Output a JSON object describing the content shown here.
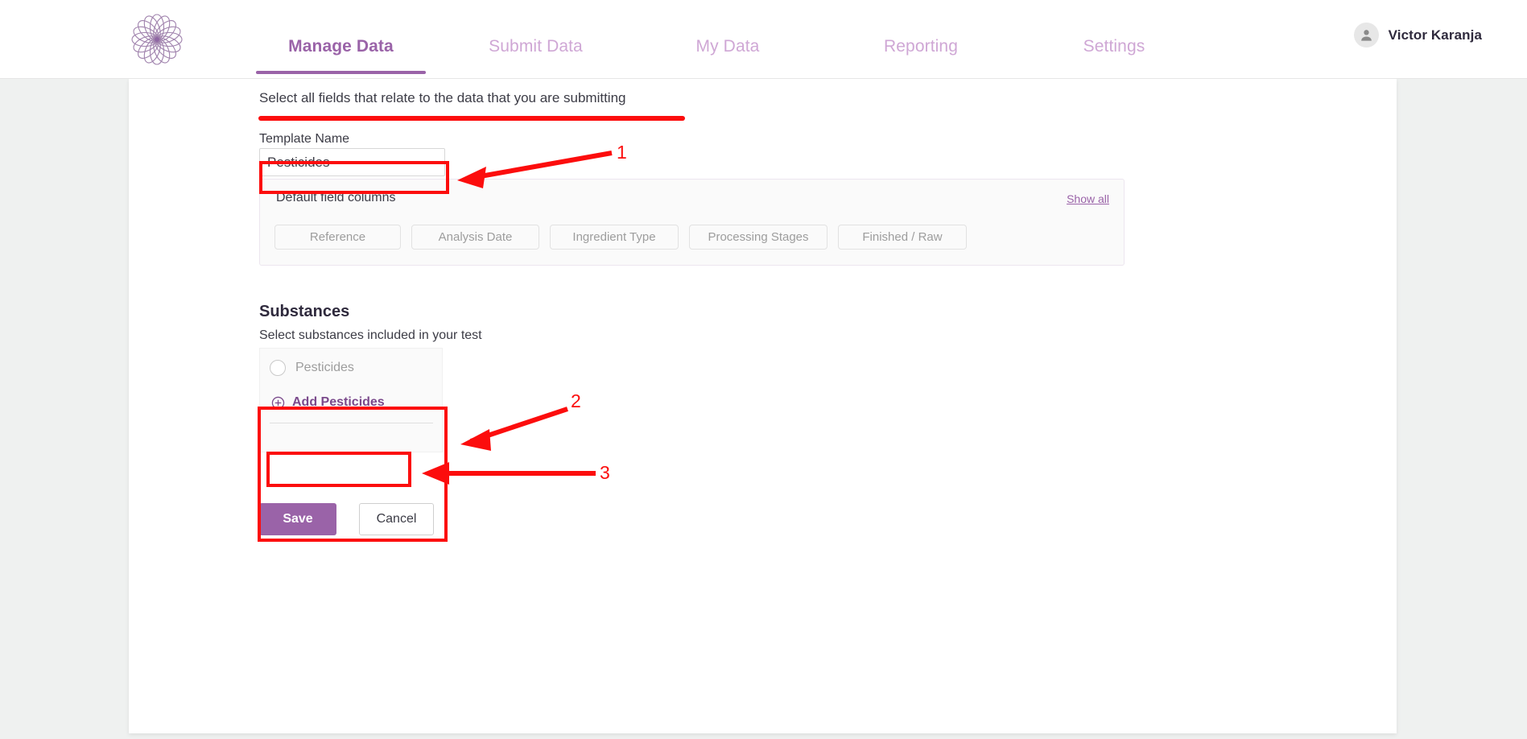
{
  "brand": {
    "logo_icon": "flower-mandala-logo",
    "accent_color": "#9a63a8",
    "nav_inactive_color": "#cfa7d5",
    "annotation_color": "#fc0d0d"
  },
  "nav": {
    "items": [
      {
        "label": "Manage Data",
        "active": true
      },
      {
        "label": "Submit Data",
        "active": false
      },
      {
        "label": "My Data",
        "active": false
      },
      {
        "label": "Reporting",
        "active": false
      },
      {
        "label": "Settings",
        "active": false
      }
    ]
  },
  "user": {
    "name": "Victor Karanja",
    "avatar_icon": "user-avatar-icon"
  },
  "main": {
    "lead_text": "Select all fields that relate to the data that you are submitting",
    "template_name": {
      "label": "Template Name",
      "value": "Pesticides",
      "placeholder": "Template Name"
    },
    "default_field_columns": {
      "title": "Default field columns",
      "show_all_label": "Show all",
      "chips": [
        "Reference",
        "Analysis Date",
        "Ingredient Type",
        "Processing Stages",
        "Finished / Raw"
      ]
    },
    "substances": {
      "heading": "Substances",
      "subtitle": "Select substances included in your test",
      "options": [
        {
          "label": "Pesticides",
          "selected": false,
          "icon": "radio-unchecked-icon"
        }
      ],
      "add_action": {
        "label": "Add Pesticides",
        "icon": "circle-plus-icon"
      }
    },
    "actions": {
      "save_label": "Save",
      "cancel_label": "Cancel"
    }
  },
  "annotations": {
    "markers": [
      {
        "number": "1",
        "target": "template-name-input"
      },
      {
        "number": "2",
        "target": "substances-panel"
      },
      {
        "number": "3",
        "target": "add-pesticides-button"
      }
    ],
    "underline_target": "lead-text"
  }
}
